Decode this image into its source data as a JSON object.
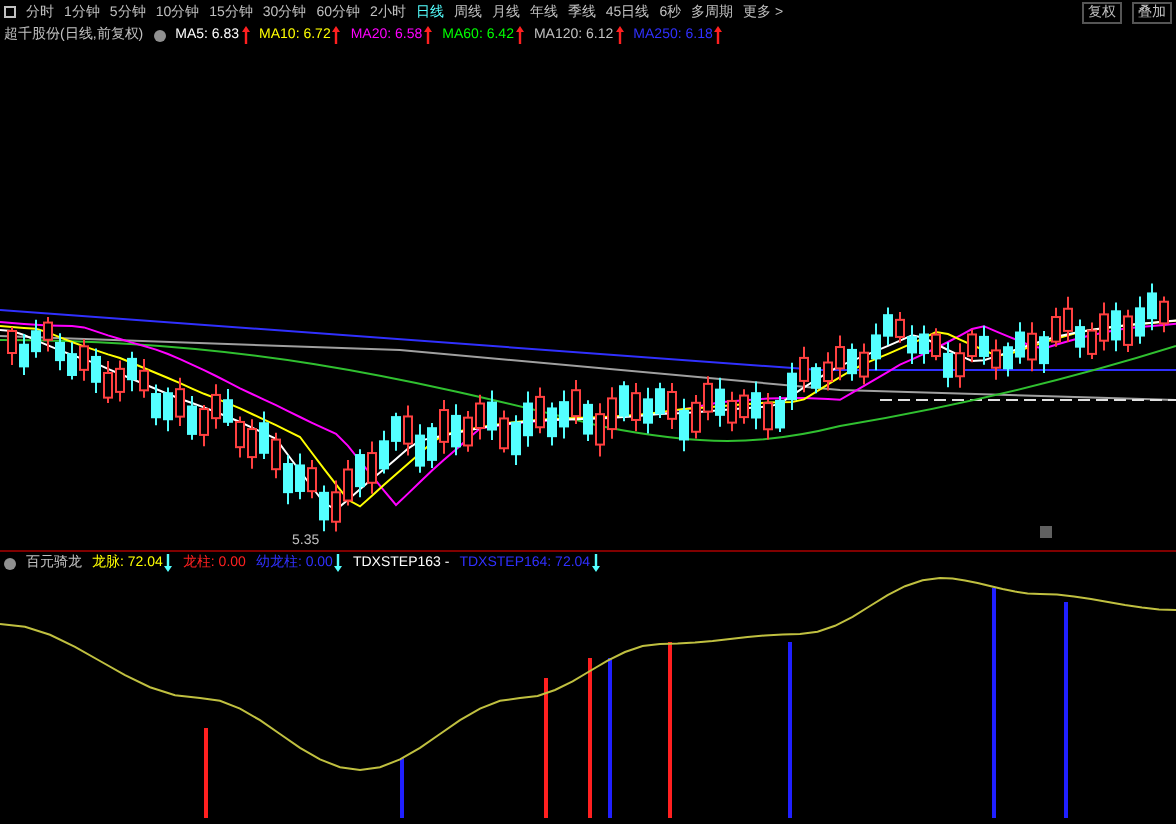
{
  "toolbar": {
    "periods": [
      {
        "label": "分时",
        "selected": false
      },
      {
        "label": "1分钟",
        "selected": false
      },
      {
        "label": "5分钟",
        "selected": false
      },
      {
        "label": "10分钟",
        "selected": false
      },
      {
        "label": "15分钟",
        "selected": false
      },
      {
        "label": "30分钟",
        "selected": false
      },
      {
        "label": "60分钟",
        "selected": false
      },
      {
        "label": "2小时",
        "selected": false
      },
      {
        "label": "日线",
        "selected": true
      },
      {
        "label": "周线",
        "selected": false
      },
      {
        "label": "月线",
        "selected": false
      },
      {
        "label": "年线",
        "selected": false
      },
      {
        "label": "季线",
        "selected": false
      },
      {
        "label": "45日线",
        "selected": false
      },
      {
        "label": "6秒",
        "selected": false
      },
      {
        "label": "多周期",
        "selected": false
      },
      {
        "label": "更多 >",
        "selected": false
      }
    ],
    "right_buttons": [
      "复权",
      "叠加"
    ]
  },
  "main_chart": {
    "title": "超千股份(日线,前复权)",
    "indicators": [
      {
        "label": "MA5: 6.83",
        "color": "#ffffff",
        "rising": true
      },
      {
        "label": "MA10: 6.72",
        "color": "#ffff00",
        "rising": true
      },
      {
        "label": "MA20: 6.58",
        "color": "#ff00ff",
        "rising": true
      },
      {
        "label": "MA60: 6.42",
        "color": "#00ff00",
        "rising": true
      },
      {
        "label": "MA120: 6.12",
        "color": "#c0c0c0",
        "rising": true
      },
      {
        "label": "MA250: 6.18",
        "color": "#3030ff",
        "rising": true
      }
    ],
    "low_label": "5.35"
  },
  "sub_chart": {
    "title": "百元骑龙",
    "indicators": [
      {
        "label": "龙脉: 72.04",
        "color": "#ffff00",
        "rising": false
      },
      {
        "label": "龙柱: 0.00",
        "color": "#ff2020"
      },
      {
        "label": "幼龙柱: 0.00",
        "color": "#3030ff",
        "rising": false
      },
      {
        "label": "TDXSTEP163 - ",
        "color": "#ffffff"
      },
      {
        "label": "TDXSTEP164: 72.04",
        "color": "#3030ff",
        "rising": false
      }
    ]
  }
}
